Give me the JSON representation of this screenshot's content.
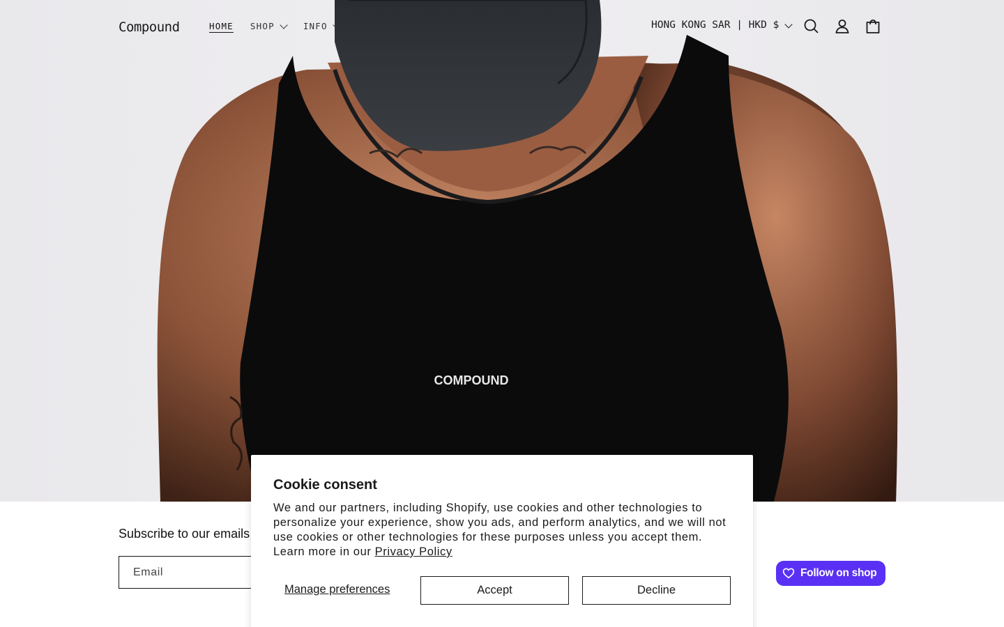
{
  "header": {
    "logo": "Compound",
    "nav": [
      {
        "label": "HOME",
        "active": true,
        "has_dropdown": false
      },
      {
        "label": "SHOP",
        "active": false,
        "has_dropdown": true
      },
      {
        "label": "INFO",
        "active": false,
        "has_dropdown": true
      }
    ],
    "region_selector": "HONG KONG SAR | HKD $",
    "icons": [
      "search-icon",
      "account-icon",
      "cart-icon"
    ]
  },
  "hero": {
    "image_description_icon": "hero-image",
    "shirt_print": "COMPOUND"
  },
  "newsletter": {
    "title": "Subscribe to our emails",
    "email_placeholder": "Email"
  },
  "shop_follow": {
    "label": "Follow on shop",
    "icon": "heart-icon",
    "color": "#5a31f4"
  },
  "cookie": {
    "title": "Cookie consent",
    "body": "We and our partners, including Shopify, use cookies and other technologies to personalize your experience, show you ads, and perform analytics, and we will not use cookies or other technologies for these purposes unless you accept them. Learn more in our ",
    "privacy_link": "Privacy Policy",
    "manage_label": "Manage preferences",
    "accept_label": "Accept",
    "decline_label": "Decline"
  }
}
